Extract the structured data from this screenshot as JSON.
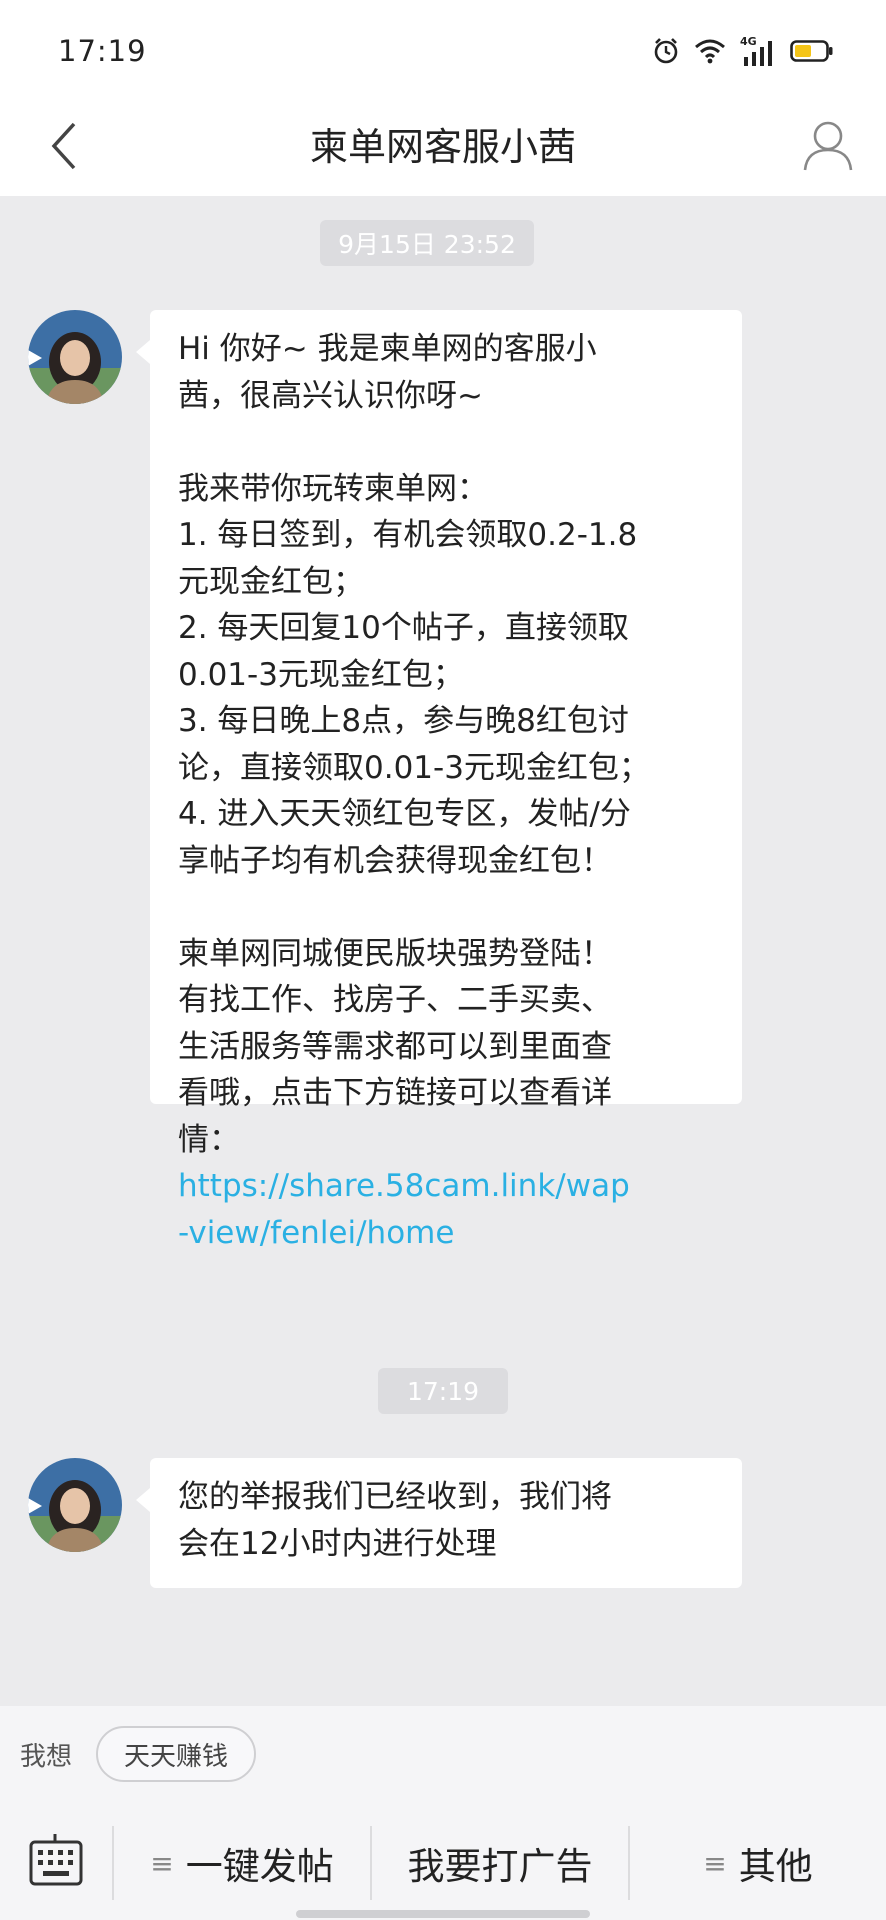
{
  "status_bar": {
    "time": "17:19",
    "network_label": "4G",
    "icons": [
      "alarm-icon",
      "wifi-icon",
      "signal-icon",
      "battery-icon"
    ]
  },
  "header": {
    "title": "柬单网客服小茜",
    "back_icon": "chevron-left-icon",
    "profile_icon": "person-icon"
  },
  "chat": {
    "messages": [
      {
        "timestamp": "9月15日 23:52",
        "paragraphs": [
          "Hi 你好~ 我是柬单网的客服小\n茜，很高兴认识你呀~",
          "我来带你玩转柬单网：\n1. 每日签到，有机会领取0.2-1.8\n元现金红包；\n2. 每天回复10个帖子，直接领取\n0.01-3元现金红包；\n3. 每日晚上8点，参与晚8红包讨\n论，直接领取0.01-3元现金红包；\n4. 进入天天领红包专区，发帖/分\n享帖子均有机会获得现金红包！",
          "柬单网同城便民版块强势登陆！\n有找工作、找房子、二手买卖、\n生活服务等需求都可以到里面查\n看哦，点击下方链接可以查看详\n情："
        ],
        "link": "https://share.58cam.link/wap\n-view/fenlei/home"
      },
      {
        "timestamp": "17:19",
        "text": "您的举报我们已经收到，我们将\n会在12小时内进行处理"
      }
    ]
  },
  "quick_reply": {
    "label": "我想",
    "chip": "天天赚钱"
  },
  "bottom_bar": {
    "keyboard_icon": "keyboard-icon",
    "buttons": [
      {
        "label": "一键发帖",
        "icon": "menu-lines-icon"
      },
      {
        "label": "我要打广告"
      },
      {
        "label": "其他",
        "icon": "menu-lines-icon"
      }
    ]
  },
  "colors": {
    "background": "#ebebed",
    "bubble": "#ffffff",
    "link": "#2ab0e3",
    "timestamp_chip": "#dcdcdf",
    "battery_fill": "#f5c518"
  }
}
